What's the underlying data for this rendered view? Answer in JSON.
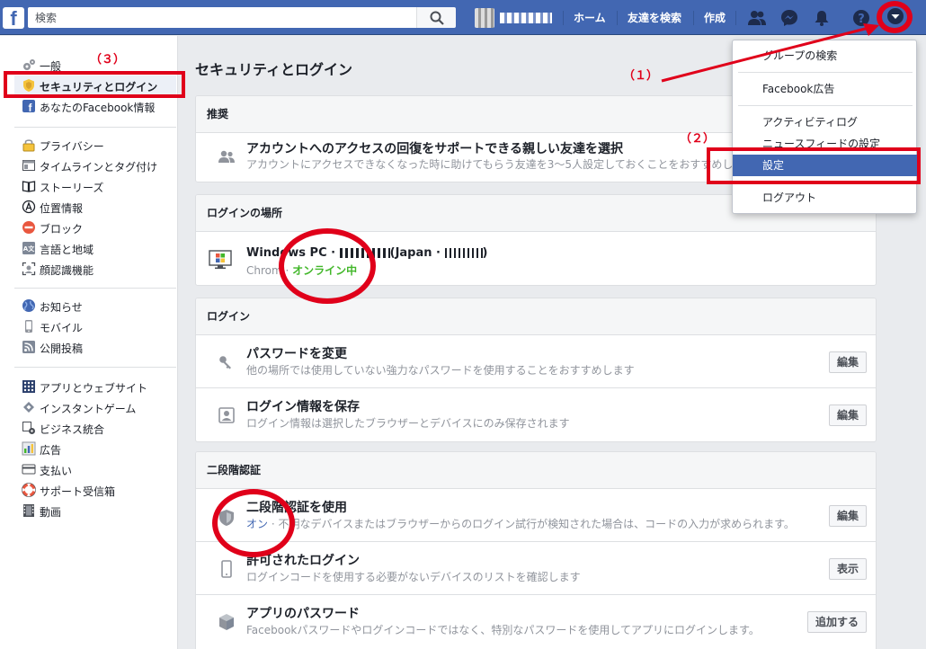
{
  "topbar": {
    "logo": "f",
    "search_placeholder": "検索",
    "home": "ホーム",
    "find_friends": "友達を検索",
    "create": "作成",
    "colors": {
      "brand": "#4267b2"
    }
  },
  "leftnav": {
    "groups": [
      [
        {
          "label": "一般",
          "icon": "gear-icon"
        },
        {
          "label": "セキュリティとログイン",
          "icon": "badge-icon",
          "active": true
        },
        {
          "label": "あなたのFacebook情報",
          "icon": "facebook-icon"
        }
      ],
      [
        {
          "label": "プライバシー",
          "icon": "lock-icon"
        },
        {
          "label": "タイムラインとタグ付け",
          "icon": "timeline-icon"
        },
        {
          "label": "ストーリーズ",
          "icon": "book-icon"
        },
        {
          "label": "位置情報",
          "icon": "location-icon"
        },
        {
          "label": "ブロック",
          "icon": "block-icon"
        },
        {
          "label": "言語と地域",
          "icon": "language-icon"
        },
        {
          "label": "顔認識機能",
          "icon": "face-icon"
        }
      ],
      [
        {
          "label": "お知らせ",
          "icon": "globe-icon"
        },
        {
          "label": "モバイル",
          "icon": "mobile-icon"
        },
        {
          "label": "公開投稿",
          "icon": "rss-icon"
        }
      ],
      [
        {
          "label": "アプリとウェブサイト",
          "icon": "apps-icon"
        },
        {
          "label": "インスタントゲーム",
          "icon": "game-icon"
        },
        {
          "label": "ビジネス統合",
          "icon": "business-icon"
        },
        {
          "label": "広告",
          "icon": "ads-icon"
        },
        {
          "label": "支払い",
          "icon": "card-icon"
        },
        {
          "label": "サポート受信箱",
          "icon": "lifebuoy-icon"
        },
        {
          "label": "動画",
          "icon": "film-icon"
        }
      ]
    ]
  },
  "main": {
    "title": "セキュリティとログイン",
    "sections": {
      "recommended": {
        "header": "推奨",
        "row": {
          "title": "アカウントへのアクセスの回復をサポートできる親しい友達を選択",
          "desc": "アカウントにアクセスできなくなった時に助けてもらう友達を3～5人設定しておくことをおすすめし"
        }
      },
      "where_logged_in": {
        "header": "ログインの場所",
        "row": {
          "title_a": "Windows PC · ",
          "title_b": "(Japan · ",
          "title_c": ")",
          "desc_a": "Chrom",
          "desc_sep": " · ",
          "desc_b": "オンライン中"
        }
      },
      "login": {
        "header": "ログイン",
        "rows": [
          {
            "title": "パスワードを変更",
            "desc": "他の場所では使用していない強力なパスワードを使用することをおすすめします",
            "button": "編集"
          },
          {
            "title": "ログイン情報を保存",
            "desc": "ログイン情報は選択したブラウザーとデバイスにのみ保存されます",
            "button": "編集"
          }
        ]
      },
      "two_factor": {
        "header": "二段階認証",
        "rows": [
          {
            "title": "二段階認証を使用",
            "desc_on": "オン",
            "desc": " · 不明なデバイスまたはブラウザーからのログイン試行が検知された場合は、コードの入力が求められます。",
            "button": "編集"
          },
          {
            "title": "許可されたログイン",
            "desc": "ログインコードを使用する必要がないデバイスのリストを確認します",
            "button": "表示"
          },
          {
            "title": "アプリのパスワード",
            "desc": "Facebookパスワードやログインコードではなく、特別なパスワードを使用してアプリにログインします。",
            "button": "追加する"
          }
        ]
      }
    }
  },
  "menu": {
    "items": [
      "グループの検索",
      "Facebook広告",
      "アクティビティログ",
      "ニュースフィードの設定",
      "設定",
      "ログアウト"
    ]
  },
  "annotations": {
    "label1": "（１）",
    "label2": "（２）",
    "label3": "（３）",
    "color": "#e0001a"
  }
}
